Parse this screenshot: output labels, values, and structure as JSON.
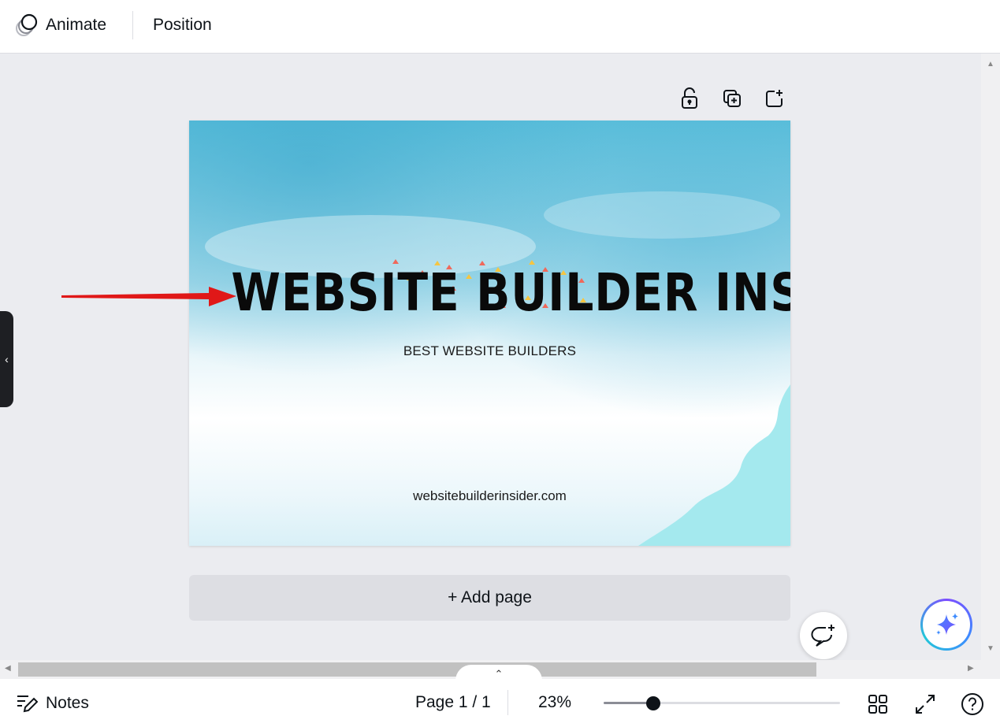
{
  "toolbar": {
    "animate_label": "Animate",
    "position_label": "Position"
  },
  "page_tools": {
    "icons": [
      "unlock-icon",
      "duplicate-page-icon",
      "add-page-icon"
    ]
  },
  "slide": {
    "title": "WEBSITE BUILDER INSIDER",
    "subtitle": "BEST WEBSITE BUILDERS",
    "url": "websitebuilderinsider.com",
    "colors": {
      "watercolor": "#5bbfdb",
      "wave": "#a4e9ee",
      "confetti_red": "#f0685a",
      "confetti_yellow": "#f5c542",
      "arrow": "#e01818"
    }
  },
  "add_page_label": "+ Add page",
  "bottom": {
    "notes_label": "Notes",
    "page_indicator": "Page 1 / 1",
    "zoom_label": "23%",
    "zoom_fraction": 0.21
  },
  "colors": {
    "canvas_bg": "#ebecf0",
    "toolbar_bg": "#ffffff",
    "magic_gradient": [
      "#7b4dff",
      "#3d8bff",
      "#23c6d8"
    ]
  }
}
